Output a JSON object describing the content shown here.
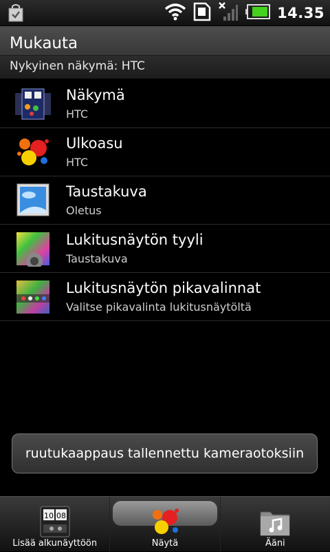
{
  "status_bar": {
    "time": "14.35",
    "icons": [
      "shopping-bag-icon",
      "wifi-icon",
      "sd-card-icon",
      "signal-off-icon",
      "battery-icon"
    ],
    "battery_color": "#45d11e"
  },
  "header": {
    "title": "Mukauta",
    "current_view": "Nykyinen näkymä: HTC"
  },
  "list": {
    "items": [
      {
        "title": "Näkymä",
        "subtitle": "HTC",
        "icon": "scene-icon"
      },
      {
        "title": "Ulkoasu",
        "subtitle": "HTC",
        "icon": "skin-paint-icon"
      },
      {
        "title": "Taustakuva",
        "subtitle": "Oletus",
        "icon": "wallpaper-icon"
      },
      {
        "title": "Lukitusnäytön tyyli",
        "subtitle": "Taustakuva",
        "icon": "lockscreen-style-icon"
      },
      {
        "title": "Lukitusnäytön pikavalinnat",
        "subtitle": "Valitse pikavalinta lukitusnäytöltä",
        "icon": "lockscreen-shortcuts-icon"
      }
    ]
  },
  "toast": {
    "message": "ruutukaappaus tallennettu kameraotoksiin"
  },
  "tabs": [
    {
      "label": "Lisää alkunäyttöön",
      "icon": "clock-widget-icon",
      "active": false
    },
    {
      "label": "Näytä",
      "icon": "paint-splash-icon",
      "active": true
    },
    {
      "label": "Ääni",
      "icon": "music-folder-icon",
      "active": false
    }
  ]
}
